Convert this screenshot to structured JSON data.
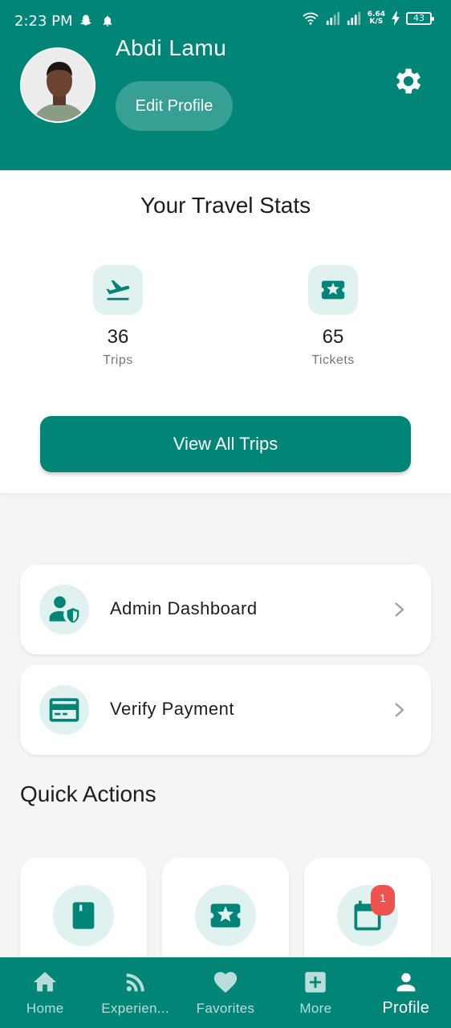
{
  "status_bar": {
    "time": "2:23 PM",
    "speed_top": "6.64",
    "speed_bottom": "K/S",
    "battery": "43",
    "icons": [
      "snapchat-icon",
      "notification-bell-icon",
      "wifi-icon",
      "signal-icon",
      "signal-icon",
      "charging-icon",
      "battery-icon"
    ]
  },
  "profile": {
    "name": "Abdi Lamu",
    "edit_label": "Edit Profile",
    "settings_icon": "gear-icon"
  },
  "stats": {
    "title": "Your Travel Stats",
    "items": [
      {
        "icon": "flight-takeoff-icon",
        "value": "36",
        "label": "Trips"
      },
      {
        "icon": "ticket-star-icon",
        "value": "65",
        "label": "Tickets"
      }
    ],
    "view_all_label": "View All Trips"
  },
  "menu": [
    {
      "icon": "admin-user-shield-icon",
      "label": "Admin Dashboard"
    },
    {
      "icon": "credit-card-icon",
      "label": "Verify Payment"
    }
  ],
  "quick_actions": {
    "title": "Quick Actions",
    "items": [
      {
        "icon": "bookmark-book-icon"
      },
      {
        "icon": "ticket-star-icon"
      },
      {
        "icon": "calendar-icon",
        "badge": "1"
      }
    ]
  },
  "bottom_nav": {
    "items": [
      {
        "icon": "home-icon",
        "label": "Home"
      },
      {
        "icon": "rss-feed-icon",
        "label": "Experien..."
      },
      {
        "icon": "heart-icon",
        "label": "Favorites"
      },
      {
        "icon": "add-box-icon",
        "label": "More"
      },
      {
        "icon": "person-icon",
        "label": "Profile"
      }
    ],
    "active": "Profile"
  },
  "colors": {
    "primary": "#008577",
    "icon_bg": "#e0f2f0",
    "badge": "#ef5350",
    "background": "#f5f5f5"
  }
}
